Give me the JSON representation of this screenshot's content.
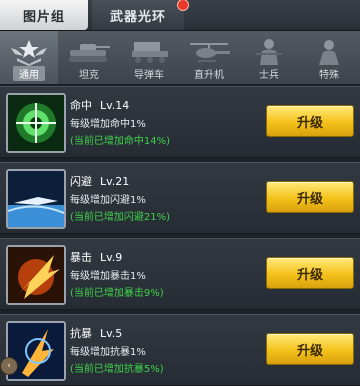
{
  "tabs": [
    {
      "label": "图片组",
      "active": true
    },
    {
      "label": "武器光环",
      "active": false,
      "notify": true
    }
  ],
  "categories": [
    {
      "label": "通用",
      "icon": "wings-star-icon",
      "selected": true
    },
    {
      "label": "坦克",
      "icon": "tank-icon",
      "selected": false
    },
    {
      "label": "导弹车",
      "icon": "missile-truck-icon",
      "selected": false
    },
    {
      "label": "直升机",
      "icon": "helicopter-icon",
      "selected": false
    },
    {
      "label": "士兵",
      "icon": "soldier-icon",
      "selected": false
    },
    {
      "label": "特殊",
      "icon": "special-unit-icon",
      "selected": false
    }
  ],
  "skills": [
    {
      "name": "命中",
      "level": "Lv.14",
      "desc": "每级增加命中1%",
      "total": "(当前已增加命中14%)",
      "button": "升级",
      "icon": "crosshair-burst-icon"
    },
    {
      "name": "闪避",
      "level": "Lv.21",
      "desc": "每级增加闪避1%",
      "total": "(当前已增加闪避21%)",
      "button": "升级",
      "icon": "dodge-jet-icon"
    },
    {
      "name": "暴击",
      "level": "Lv.9",
      "desc": "每级增加暴击1%",
      "total": "(当前已增加暴击9%)",
      "button": "升级",
      "icon": "critical-strike-icon"
    },
    {
      "name": "抗暴",
      "level": "Lv.5",
      "desc": "每级增加抗暴1%",
      "total": "(当前已增加抗暴5%)",
      "button": "升级",
      "icon": "crit-resist-icon"
    }
  ],
  "colors": {
    "accent_yellow": "#f4c21a",
    "bonus_green": "#3fd24a",
    "notify_red": "#e83a2a"
  }
}
